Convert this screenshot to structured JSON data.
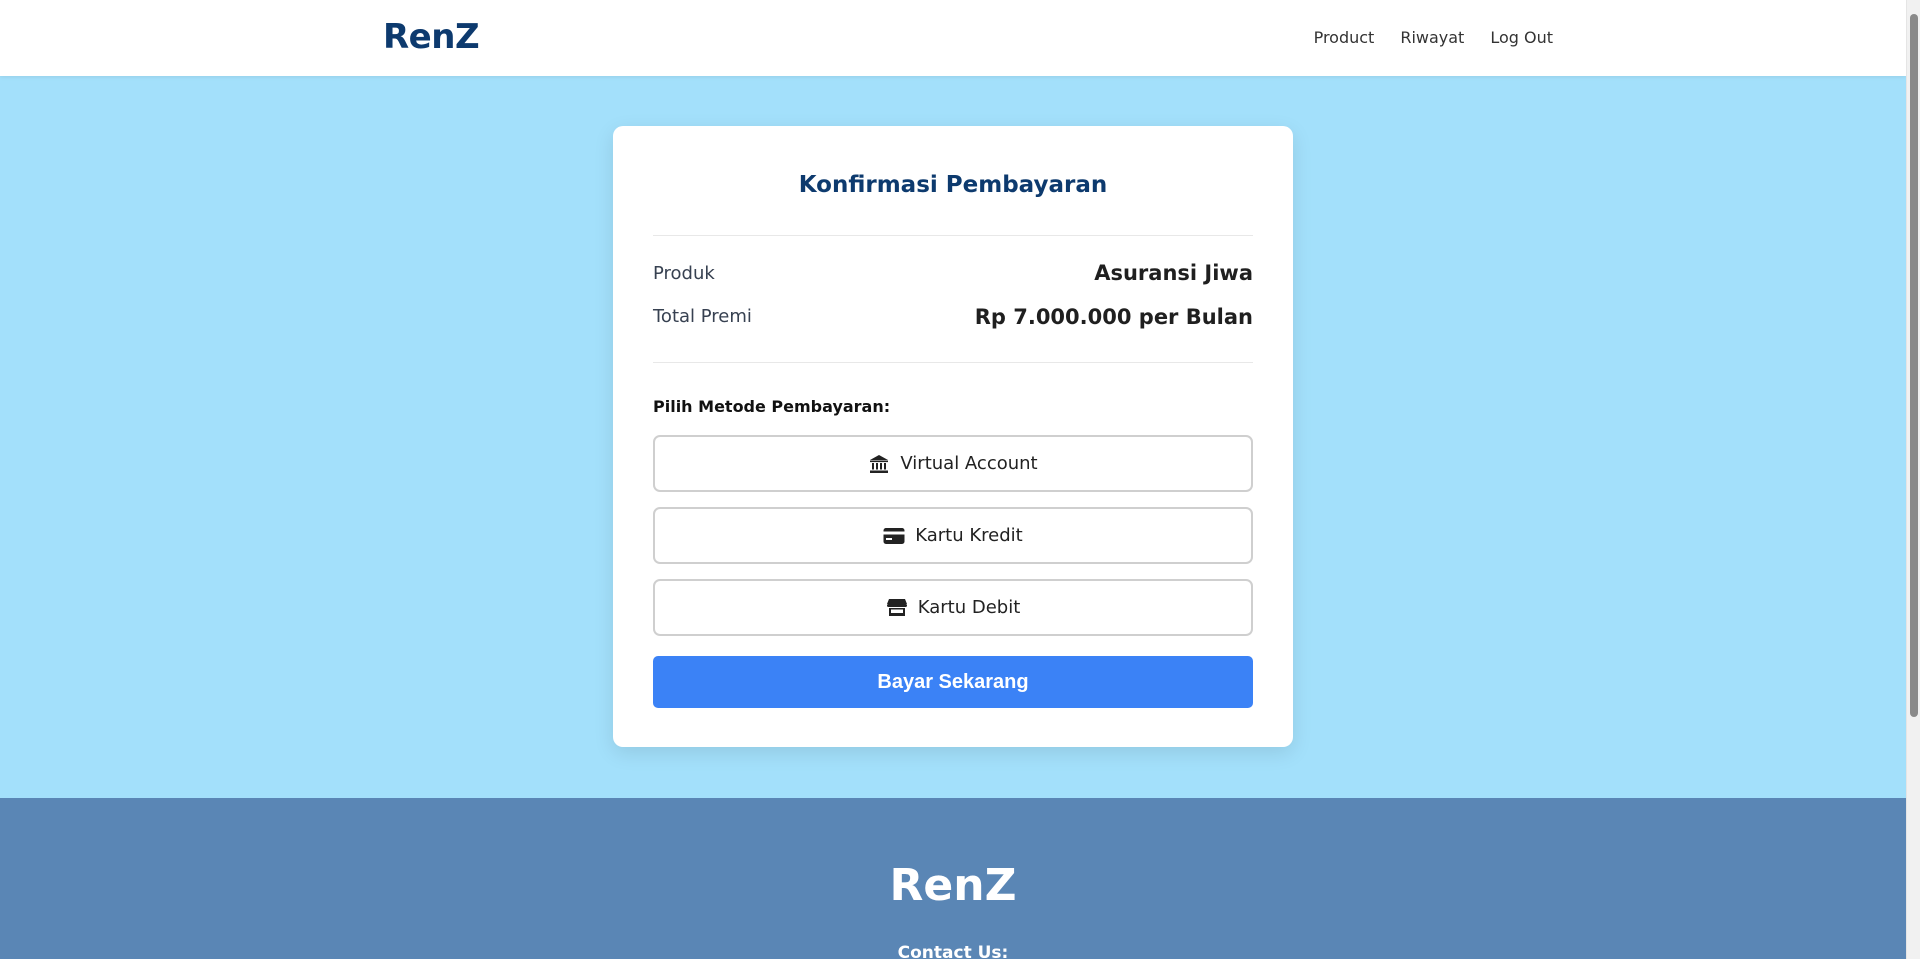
{
  "header": {
    "brand": "RenZ",
    "nav": [
      {
        "label": "Product"
      },
      {
        "label": "Riwayat"
      },
      {
        "label": "Log Out"
      }
    ]
  },
  "card": {
    "title": "Konfirmasi Pembayaran",
    "product_label": "Produk",
    "product_value": "Asuransi Jiwa",
    "premium_label": "Total Premi",
    "premium_value": "Rp 7.000.000 per Bulan",
    "method_title": "Pilih Metode Pembayaran:",
    "methods": [
      {
        "label": "Virtual Account",
        "icon": "bank-icon"
      },
      {
        "label": "Kartu Kredit",
        "icon": "credit-card-icon"
      },
      {
        "label": "Kartu Debit",
        "icon": "store-icon"
      }
    ],
    "pay_button": "Bayar Sekarang"
  },
  "footer": {
    "brand": "RenZ",
    "contact": "Contact Us:"
  },
  "colors": {
    "background": "#a3e0fb",
    "brand_navy": "#0d3a6e",
    "pay_button": "#3b82f6",
    "footer": "#5a86b5"
  }
}
